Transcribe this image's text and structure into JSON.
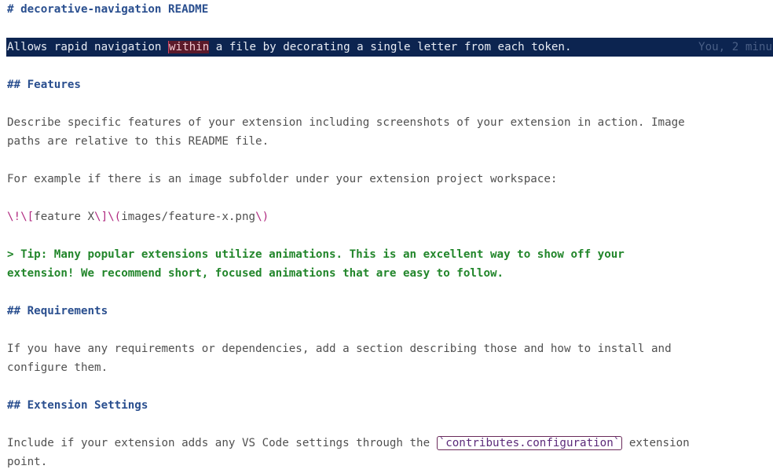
{
  "editor": {
    "lines": {
      "h1": "# decorative-navigation README",
      "desc_before": "Allows rapid navigation ",
      "desc_match": "within",
      "desc_after": " a file by decorating a single letter from each token.",
      "blame": "You, 2 minu",
      "h2_features": "## Features",
      "features_p1": "Describe specific features of your extension including screenshots of your extension in action. Image",
      "features_p2": "paths are relative to this README file.",
      "example": "For example if there is an image subfolder under your extension project workspace:",
      "img_esc1": "\\!\\[",
      "img_text": "feature X",
      "img_esc2": "\\]\\(",
      "img_path": "images/feature-x.png",
      "img_esc3": "\\)",
      "tip_1": "> Tip: Many popular extensions utilize animations. This is an excellent way to show off your",
      "tip_2": "extension! We recommend short, focused animations that are easy to follow.",
      "h2_requirements": "## Requirements",
      "req_1": "If you have any requirements or dependencies, add a section describing those and how to install and",
      "req_2": "configure them.",
      "h2_settings": "## Extension Settings",
      "settings_before": "Include if your extension adds any VS Code settings through the ",
      "settings_code": "`contributes.configuration`",
      "settings_after": " extension",
      "settings_2": "point."
    }
  }
}
